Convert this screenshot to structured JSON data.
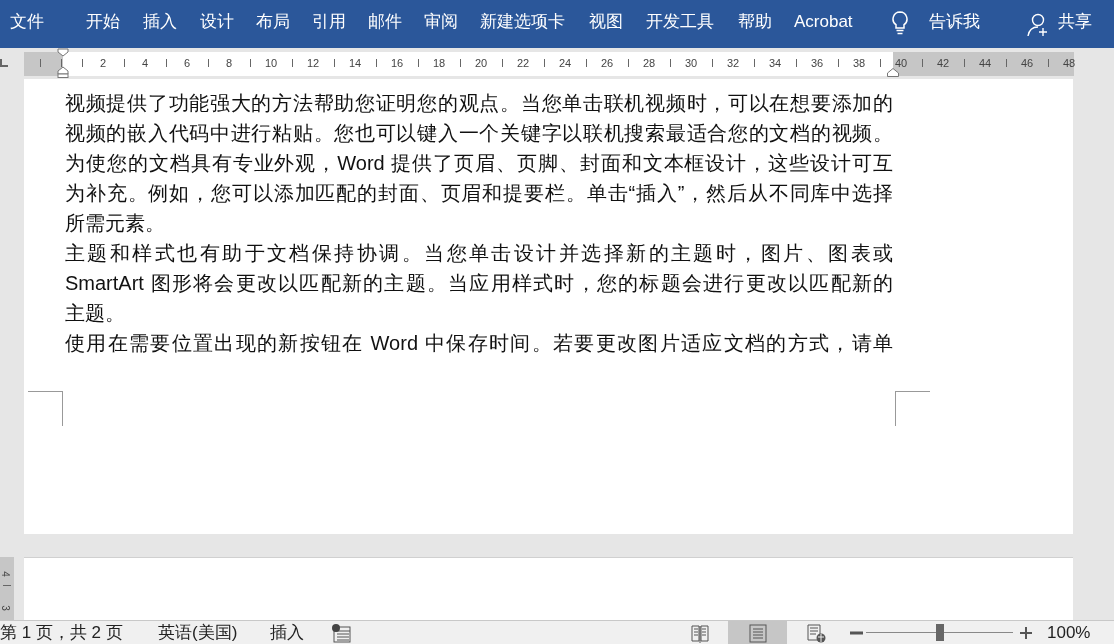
{
  "ribbon": {
    "tabs": [
      {
        "label": "文件",
        "selected": false
      },
      {
        "label": "开始",
        "selected": false
      },
      {
        "label": "插入",
        "selected": false
      },
      {
        "label": "设计",
        "selected": false
      },
      {
        "label": "布局",
        "selected": false
      },
      {
        "label": "引用",
        "selected": false
      },
      {
        "label": "邮件",
        "selected": false
      },
      {
        "label": "审阅",
        "selected": false
      },
      {
        "label": "新建选项卡",
        "selected": false
      },
      {
        "label": "视图",
        "selected": false
      },
      {
        "label": "开发工具",
        "selected": false
      },
      {
        "label": "帮助",
        "selected": false
      },
      {
        "label": "Acrobat",
        "selected": false
      }
    ],
    "tell_me": "告诉我",
    "share": "共享"
  },
  "ruler": {
    "labels": [
      "2",
      "4",
      "6",
      "8",
      "10",
      "12",
      "14",
      "16",
      "18",
      "20",
      "22",
      "24",
      "26",
      "28",
      "30",
      "32",
      "34",
      "36",
      "38",
      "40",
      "42",
      "44",
      "46",
      "48"
    ]
  },
  "document": {
    "paragraphs": [
      {
        "lines": [
          "视频提供了功能强大的方法帮助您证明您的观点。当您单击联机视频时，可以在想要添加的",
          "视频的嵌入代码中进行粘贴。您也可以键入一个关键字以联机搜索最适合您的文档的视频。",
          "为使您的文档具有专业外观，Word 提供了页眉、页脚、封面和文本框设计，这些设计可互",
          "为补充。例如，您可以添加匹配的封面、页眉和提要栏。单击“插入”，然后从不同库中选择",
          "所需元素。"
        ],
        "continues": false
      },
      {
        "lines": [
          "主题和样式也有助于文档保持协调。当您单击设计并选择新的主题时，图片、图表或",
          "SmartArt 图形将会更改以匹配新的主题。当应用样式时，您的标题会进行更改以匹配新的",
          "主题。"
        ],
        "continues": false
      },
      {
        "lines": [
          "使用在需要位置出现的新按钮在 Word 中保存时间。若要更改图片适应文档的方式，请单"
        ],
        "continues": true
      }
    ]
  },
  "vertical_ruler": {
    "labels": [
      "4",
      "3"
    ]
  },
  "status_bar": {
    "page": "第 1 页，共 2 页",
    "language": "英语(美国)",
    "mode": "插入",
    "views": [
      {
        "kind": "read",
        "selected": false
      },
      {
        "kind": "print",
        "selected": true
      },
      {
        "kind": "web",
        "selected": false
      }
    ],
    "zoom": {
      "level": 0.5,
      "reading": "100%"
    }
  }
}
